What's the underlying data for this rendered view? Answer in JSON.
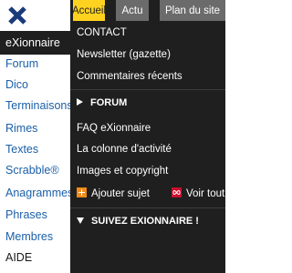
{
  "sidebar": {
    "items": [
      {
        "label": "eXionnaire",
        "style": "dark"
      },
      {
        "label": "Forum",
        "style": "link"
      },
      {
        "label": "Dico",
        "style": "link"
      },
      {
        "label": "Terminaisons",
        "style": "link"
      },
      {
        "label": "Rimes",
        "style": "link"
      },
      {
        "label": "Textes",
        "style": "link"
      },
      {
        "label": "Scrabble®",
        "style": "link"
      },
      {
        "label": "Anagrammes",
        "style": "link"
      },
      {
        "label": "Phrases",
        "style": "link"
      },
      {
        "label": "Membres",
        "style": "link"
      },
      {
        "label": "AIDE",
        "style": "plain"
      }
    ]
  },
  "tabs": [
    {
      "label": "Accueil",
      "active": true
    },
    {
      "label": "Actu",
      "active": false
    },
    {
      "label": "Plan du site",
      "active": false
    }
  ],
  "menu": {
    "contact": "CONTACT",
    "newsletter": "Newsletter (gazette)",
    "recent_comments": "Commentaires récents",
    "forum_heading": "FORUM",
    "faq": "FAQ eXionnaire",
    "activity_column": "La colonne d'activité",
    "images_copyright": "Images et copyright",
    "add_subject": "Ajouter sujet",
    "see_all": "Voir tout",
    "follow_heading": "SUIVEZ EXIONNAIRE !"
  },
  "colors": {
    "panel_bg": "#1f1f1f",
    "active_tab": "#ffd21f",
    "inactive_tab": "#6b6b6b",
    "link": "#1a5fa8",
    "close_icon": "#1a3b7a",
    "add_icon": "#f08c1a",
    "see_all_icon": "#c8102e"
  }
}
